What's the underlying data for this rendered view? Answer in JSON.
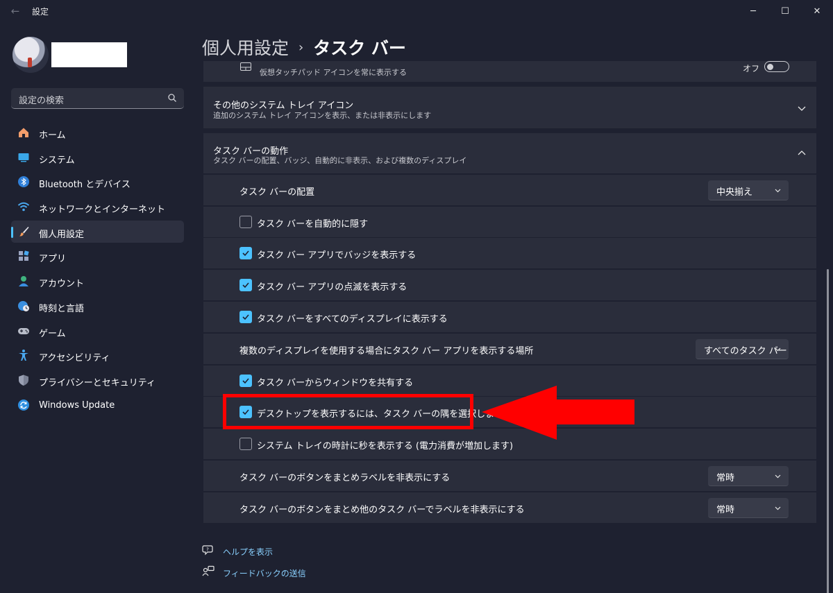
{
  "window": {
    "title": "設定",
    "controls": {
      "minimize": "─",
      "maximize": "☐",
      "close": "✕"
    }
  },
  "sidebar": {
    "search_placeholder": "設定の検索",
    "items": [
      {
        "label": "ホーム",
        "icon": "home-icon",
        "active": false
      },
      {
        "label": "システム",
        "icon": "system-icon",
        "active": false
      },
      {
        "label": "Bluetooth とデバイス",
        "icon": "bluetooth-icon",
        "active": false
      },
      {
        "label": "ネットワークとインターネット",
        "icon": "wifi-icon",
        "active": false
      },
      {
        "label": "個人用設定",
        "icon": "brush-icon",
        "active": true
      },
      {
        "label": "アプリ",
        "icon": "apps-icon",
        "active": false
      },
      {
        "label": "アカウント",
        "icon": "account-icon",
        "active": false
      },
      {
        "label": "時刻と言語",
        "icon": "time-language-icon",
        "active": false
      },
      {
        "label": "ゲーム",
        "icon": "gamepad-icon",
        "active": false
      },
      {
        "label": "アクセシビリティ",
        "icon": "accessibility-icon",
        "active": false
      },
      {
        "label": "プライバシーとセキュリティ",
        "icon": "shield-icon",
        "active": false
      },
      {
        "label": "Windows Update",
        "icon": "windows-update-icon",
        "active": false
      }
    ]
  },
  "breadcrumb": {
    "parent": "個人用設定",
    "separator": "›",
    "current": "タスク バー"
  },
  "partial_row": {
    "label": "仮想タッチパッド アイコンを常に表示する",
    "toggle_state": "オフ"
  },
  "tray_section": {
    "title": "その他のシステム トレイ アイコン",
    "subtitle": "追加のシステム トレイ アイコンを表示、または非表示にします"
  },
  "behavior_section": {
    "title": "タスク バーの動作",
    "subtitle": "タスク バーの配置、バッジ、自動的に非表示、および複数のディスプレイ",
    "rows": [
      {
        "type": "dropdown",
        "label": "タスク バーの配置",
        "value": "中央揃え"
      },
      {
        "type": "checkbox",
        "label": "タスク バーを自動的に隠す",
        "checked": false
      },
      {
        "type": "checkbox",
        "label": "タスク バー アプリでバッジを表示する",
        "checked": true
      },
      {
        "type": "checkbox",
        "label": "タスク バー アプリの点滅を表示する",
        "checked": true
      },
      {
        "type": "checkbox",
        "label": "タスク バーをすべてのディスプレイに表示する",
        "checked": true
      },
      {
        "type": "dropdown",
        "label": "複数のディスプレイを使用する場合にタスク バー アプリを表示する場所",
        "value": "すべてのタスク バー"
      },
      {
        "type": "checkbox",
        "label": "タスク バーからウィンドウを共有する",
        "checked": true
      },
      {
        "type": "checkbox",
        "label": "デスクトップを表示するには、タスク バーの隅を選択します",
        "checked": true
      },
      {
        "type": "checkbox",
        "label": "システム トレイの時計に秒を表示する (電力消費が増加します)",
        "checked": false
      },
      {
        "type": "dropdown",
        "label": "タスク バーのボタンをまとめラベルを非表示にする",
        "value": "常時"
      },
      {
        "type": "dropdown",
        "label": "タスク バーのボタンをまとめ他のタスク バーでラベルを非表示にする",
        "value": "常時"
      }
    ]
  },
  "links": [
    {
      "label": "ヘルプを表示",
      "icon": "help-icon"
    },
    {
      "label": "フィードバックの送信",
      "icon": "feedback-icon"
    }
  ],
  "colors": {
    "accent": "#4cc2ff",
    "highlight": "#ff0000",
    "background": "#1e2130",
    "card": "#2a2d3b"
  }
}
